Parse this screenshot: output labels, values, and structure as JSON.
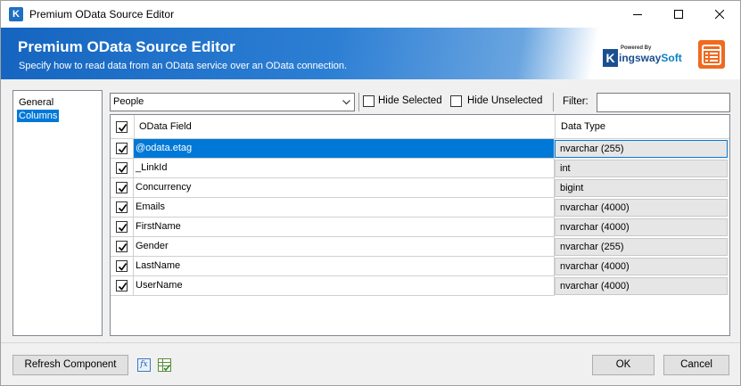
{
  "window": {
    "title": "Premium OData Source Editor",
    "app_icon_letter": "K"
  },
  "banner": {
    "title": "Premium OData Source Editor",
    "subtitle": "Specify how to read data from an OData service over an OData connection.",
    "brand_powered": "Powered By",
    "brand_k": "K",
    "brand_name_a": "ingsway",
    "brand_name_b": "Soft"
  },
  "nav": {
    "items": [
      {
        "label": "General",
        "selected": false
      },
      {
        "label": "Columns",
        "selected": true
      }
    ]
  },
  "toolbar": {
    "entity_value": "People",
    "hide_selected_label": "Hide Selected",
    "hide_unselected_label": "Hide Unselected",
    "filter_label": "Filter:",
    "filter_value": ""
  },
  "grid": {
    "headers": {
      "field": "OData Field",
      "type": "Data Type"
    },
    "rows": [
      {
        "field": "@odata.etag",
        "type": "nvarchar (255)",
        "checked": true,
        "selected": true
      },
      {
        "field": "_LinkId",
        "type": "int",
        "checked": true,
        "selected": false
      },
      {
        "field": "Concurrency",
        "type": "bigint",
        "checked": true,
        "selected": false
      },
      {
        "field": "Emails",
        "type": "nvarchar (4000)",
        "checked": true,
        "selected": false
      },
      {
        "field": "FirstName",
        "type": "nvarchar (4000)",
        "checked": true,
        "selected": false
      },
      {
        "field": "Gender",
        "type": "nvarchar (255)",
        "checked": true,
        "selected": false
      },
      {
        "field": "LastName",
        "type": "nvarchar (4000)",
        "checked": true,
        "selected": false
      },
      {
        "field": "UserName",
        "type": "nvarchar (4000)",
        "checked": true,
        "selected": false
      }
    ]
  },
  "footer": {
    "refresh_label": "Refresh Component",
    "fx_label": "fx",
    "ok_label": "OK",
    "cancel_label": "Cancel"
  },
  "colors": {
    "accent": "#0078d7",
    "banner": "#1565c0",
    "brand_orange": "#f06a20"
  }
}
